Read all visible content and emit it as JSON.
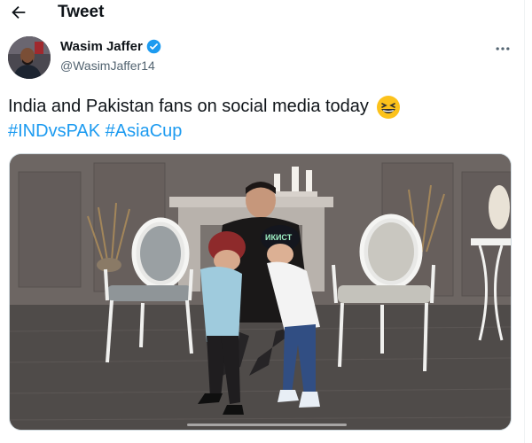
{
  "header": {
    "title": "Tweet"
  },
  "author": {
    "name": "Wasim Jaffer",
    "handle": "@WasimJaffer14"
  },
  "tweet": {
    "text": "India and Pakistan fans on social media today",
    "emoji": "grinning-squinting-face",
    "hashtags": [
      "#INDvsPAK",
      "#AsiaCup"
    ]
  },
  "media": {
    "type": "video",
    "cap_text": "ИКИСТ"
  },
  "colors": {
    "link": "#1d9bf0",
    "verified": "#1d9bf0",
    "text": "#0f1419",
    "secondary": "#536471"
  }
}
